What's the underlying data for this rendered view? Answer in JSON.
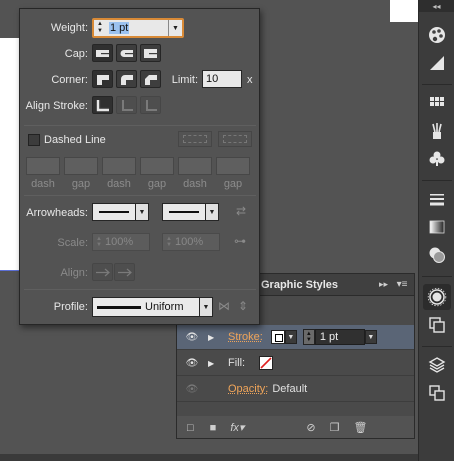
{
  "stroke_panel": {
    "weight_label": "Weight:",
    "weight_value": "1 pt",
    "cap_label": "Cap:",
    "corner_label": "Corner:",
    "limit_label": "Limit:",
    "limit_value": "10",
    "limit_unit": "x",
    "align_label": "Align Stroke:",
    "dashed_label": "Dashed Line",
    "dash_labels": [
      "dash",
      "gap",
      "dash",
      "gap",
      "dash",
      "gap"
    ],
    "arrowheads_label": "Arrowheads:",
    "scale_label": "Scale:",
    "scale_start": "100%",
    "scale_end": "100%",
    "align_arrow_label": "Align:",
    "profile_label": "Profile:",
    "profile_value": "Uniform"
  },
  "graphic_styles": {
    "tab_label": "Graphic Styles",
    "stroke_label": "Stroke:",
    "stroke_weight": "1 pt",
    "fill_label": "Fill:",
    "opacity_label": "Opacity:",
    "opacity_value": "Default"
  },
  "colors": {
    "accent": "#d88a37",
    "selected_row": "#5a6576",
    "link": "#f0a55a"
  }
}
